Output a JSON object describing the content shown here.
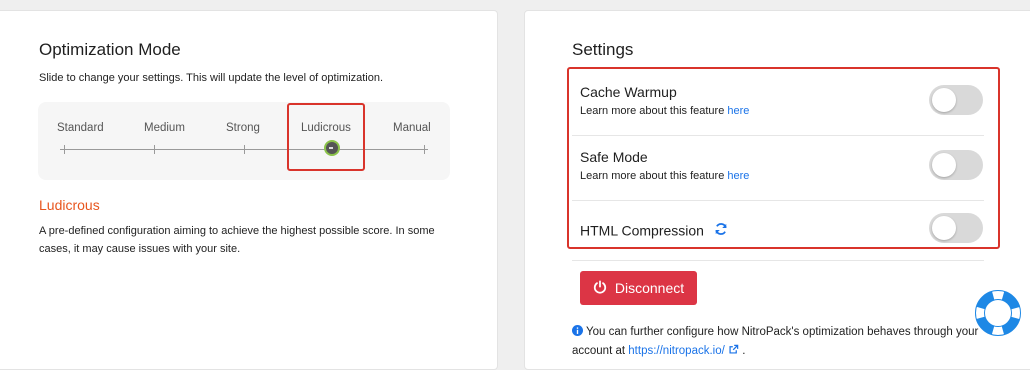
{
  "optimization": {
    "title": "Optimization Mode",
    "description": "Slide to change your settings. This will update the level of optimization.",
    "levels": [
      "Standard",
      "Medium",
      "Strong",
      "Ludicrous",
      "Manual"
    ],
    "selected_level": "Ludicrous",
    "selected_title": "Ludicrous",
    "selected_description": "A pre-defined configuration aiming to achieve the highest possible score. In some cases, it may cause issues with your site."
  },
  "settings": {
    "title": "Settings",
    "items": [
      {
        "label": "Cache Warmup",
        "sub_text": "Learn more about this feature",
        "link": "here",
        "enabled": false
      },
      {
        "label": "Safe Mode",
        "sub_text": "Learn more about this feature",
        "link": "here",
        "enabled": false
      },
      {
        "label": "HTML Compression",
        "enabled": false
      }
    ],
    "disconnect_label": "Disconnect",
    "info_text": "You can further configure how NitroPack's optimization behaves through your account at",
    "info_link": "https://nitropack.io/",
    "info_end": "."
  },
  "colors": {
    "accent_orange": "#e8561f",
    "danger": "#dc3545",
    "link": "#1a73e8",
    "highlight": "#d9342b"
  },
  "icons": [
    "power-icon",
    "refresh-icon",
    "info-icon",
    "external-link-icon",
    "lifebuoy-icon"
  ]
}
